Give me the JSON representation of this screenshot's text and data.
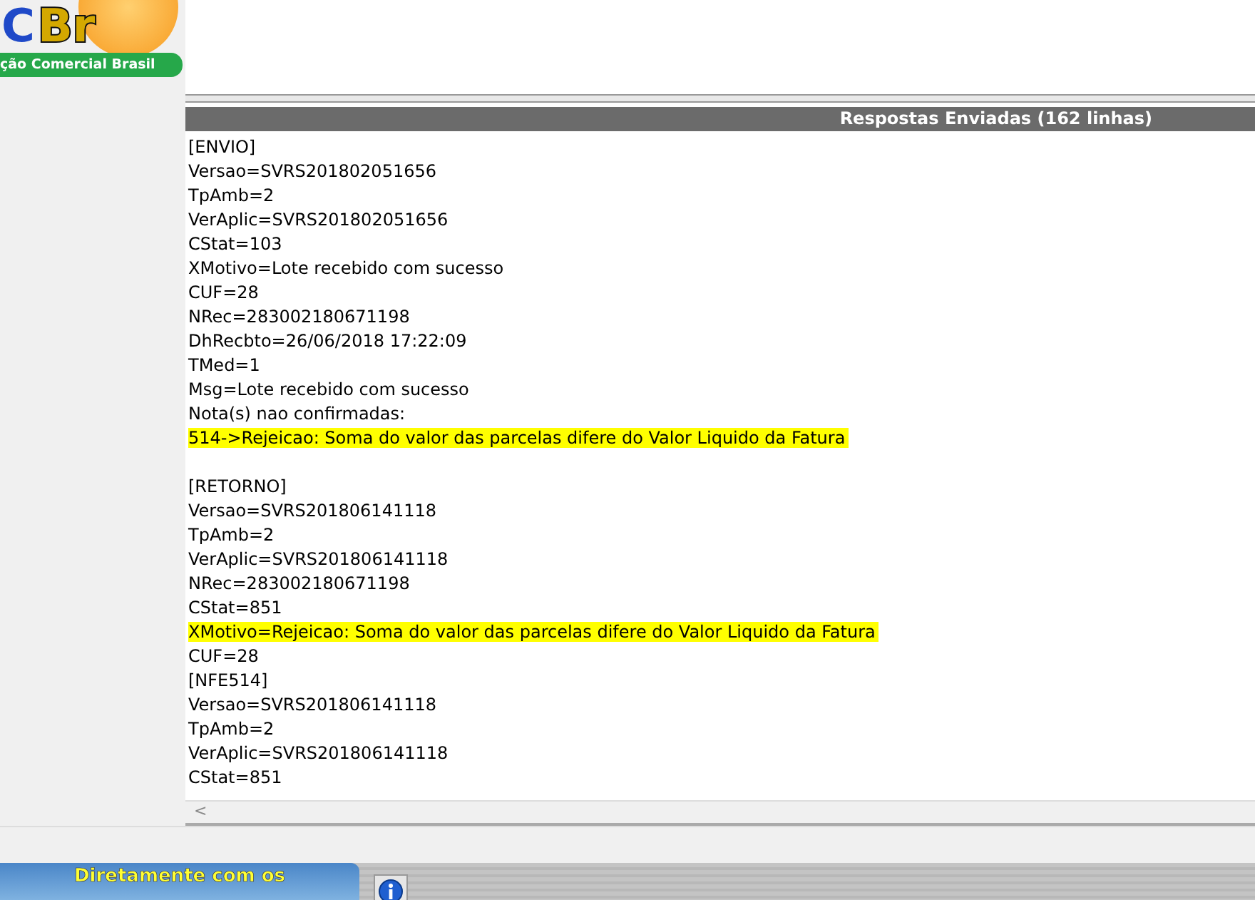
{
  "logo": {
    "mark_left": "C",
    "mark_right": "Br",
    "tagline": "ção Comercial Brasil"
  },
  "panel": {
    "title": "Respostas Enviadas (162 linhas)"
  },
  "blocks": [
    {
      "lines": [
        {
          "text": "[ENVIO]",
          "highlighted": false
        },
        {
          "text": "Versao=SVRS201802051656",
          "highlighted": false
        },
        {
          "text": "TpAmb=2",
          "highlighted": false
        },
        {
          "text": "VerAplic=SVRS201802051656",
          "highlighted": false
        },
        {
          "text": "CStat=103",
          "highlighted": false
        },
        {
          "text": "XMotivo=Lote recebido com sucesso",
          "highlighted": false
        },
        {
          "text": "CUF=28",
          "highlighted": false
        },
        {
          "text": "NRec=283002180671198",
          "highlighted": false
        },
        {
          "text": "DhRecbto=26/06/2018 17:22:09",
          "highlighted": false
        },
        {
          "text": "TMed=1",
          "highlighted": false
        },
        {
          "text": "Msg=Lote recebido com sucesso",
          "highlighted": false
        },
        {
          "text": "Nota(s) nao confirmadas:",
          "highlighted": false
        },
        {
          "text": "514->Rejeicao: Soma do valor das parcelas difere do Valor Liquido da Fatura",
          "highlighted": true
        }
      ]
    },
    {
      "lines": [
        {
          "text": "[RETORNO]",
          "highlighted": false
        },
        {
          "text": "Versao=SVRS201806141118",
          "highlighted": false
        },
        {
          "text": "TpAmb=2",
          "highlighted": false
        },
        {
          "text": "VerAplic=SVRS201806141118",
          "highlighted": false
        },
        {
          "text": "NRec=283002180671198",
          "highlighted": false
        },
        {
          "text": "CStat=851",
          "highlighted": false
        },
        {
          "text": "XMotivo=Rejeicao: Soma do valor das parcelas difere do Valor Liquido da Fatura",
          "highlighted": true
        },
        {
          "text": "CUF=28",
          "highlighted": false
        },
        {
          "text": "[NFE514]",
          "highlighted": false
        },
        {
          "text": "Versao=SVRS201806141118",
          "highlighted": false
        },
        {
          "text": "TpAmb=2",
          "highlighted": false
        },
        {
          "text": "VerAplic=SVRS201806141118",
          "highlighted": false
        },
        {
          "text": "CStat=851",
          "highlighted": false
        }
      ]
    }
  ],
  "scrollbar": {
    "arrow": "<"
  },
  "banner": {
    "text": "Diretamente com os"
  }
}
